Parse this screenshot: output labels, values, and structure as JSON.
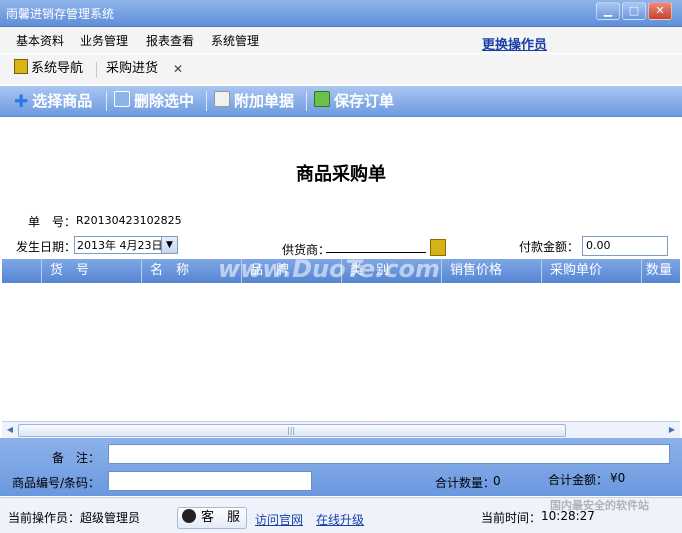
{
  "window": {
    "title": "雨馨进销存管理系统",
    "minimize": "▁",
    "maximize": "□",
    "close": "✕"
  },
  "menu": {
    "items": [
      "基本资料",
      "业务管理",
      "报表查看",
      "系统管理"
    ],
    "switch_operator": "更换操作员"
  },
  "tabs": [
    {
      "label": "系统导航",
      "icon": "nav-icon"
    },
    {
      "label": "采购进货",
      "close": "✕"
    }
  ],
  "toolbar": {
    "select_goods": "选择商品",
    "delete_selected": "删除选中",
    "attach_document": "附加单据",
    "save_order": "保存订单"
  },
  "form": {
    "title": "商品采购单",
    "order_no_label": "单　号：",
    "order_no": "R20130423102825",
    "date_label": "发生日期：",
    "date_value": "2013年  4月23日",
    "supplier_label": "供货商：",
    "payment_label": "付款金额：",
    "payment_value": "0.00"
  },
  "grid": {
    "columns": [
      "货　号",
      "名　称",
      "品　牌",
      "类　别",
      "销售价格",
      "采购单价",
      "数量"
    ],
    "rows": []
  },
  "bottom": {
    "remark_label": "备　注：",
    "code_label": "商品编号/条码：",
    "total_qty_label": "合计数量：",
    "total_qty": "0",
    "total_amount_label": "合计金额：",
    "total_amount": "¥0"
  },
  "status": {
    "operator_label": "当前操作员：",
    "operator": "超级管理员",
    "service_button": "客　服",
    "visit_site": "访问官网",
    "online_upgrade": "在线升级",
    "time_label": "当前时间：",
    "time": "10:28:27"
  },
  "watermarks": {
    "center": "www.DuoTe.com",
    "corner": "国内最安全的软件站"
  }
}
